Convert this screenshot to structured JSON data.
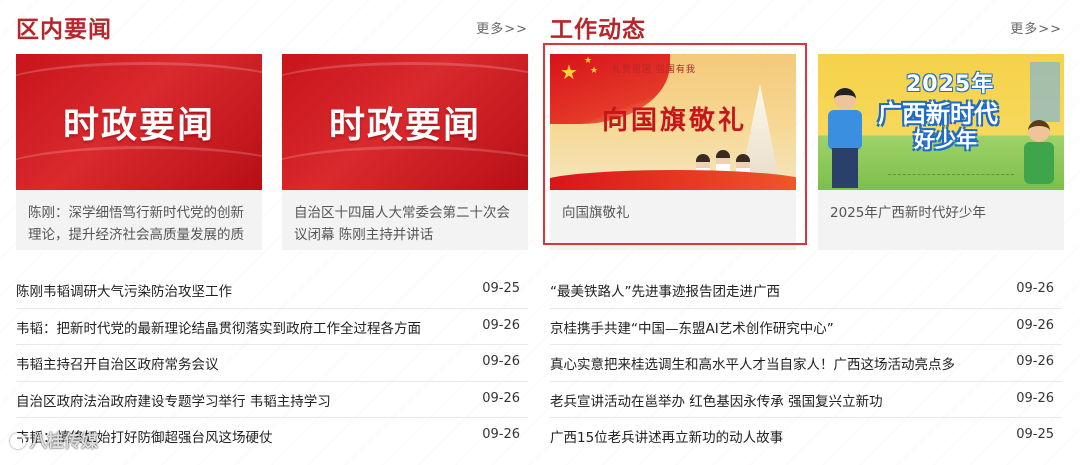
{
  "left_section": {
    "title": "区内要闻",
    "more_label": "更多>>",
    "cards": [
      {
        "image_text": "时政要闻",
        "caption": "陈刚：深学细悟笃行新时代党的创新理论，提升经济社会高质量发展的质效"
      },
      {
        "image_text": "时政要闻",
        "caption": "自治区十四届人大常委会第二十次会议闭幕 陈刚主持并讲话"
      }
    ],
    "news": [
      {
        "title": "陈刚韦韬调研大气污染防治攻坚工作",
        "date": "09-25"
      },
      {
        "title": "韦韬：把新时代党的最新理论结晶贯彻落实到政府工作全过程各方面",
        "date": "09-26"
      },
      {
        "title": "韦韬主持召开自治区政府常务会议",
        "date": "09-26"
      },
      {
        "title": "自治区政府法治政府建设专题学习举行 韦韬主持学习",
        "date": "09-26"
      },
      {
        "title": "韦韬：慎终如始打好防御超强台风这场硬仗",
        "date": "09-26"
      }
    ]
  },
  "right_section": {
    "title": "工作动态",
    "more_label": "更多>>",
    "cards": [
      {
        "image_title": "向国旗敬礼",
        "image_slogan": "礼赞祖国 强国有我",
        "caption": "向国旗敬礼",
        "selected": true
      },
      {
        "image_line1": "2025年",
        "image_line2": "广西新时代",
        "image_line3": "好少年",
        "caption": "2025年广西新时代好少年"
      }
    ],
    "news": [
      {
        "title": "“最美铁路人”先进事迹报告团走进广西",
        "date": "09-26"
      },
      {
        "title": "京桂携手共建“中国—东盟AI艺术创作研究中心”",
        "date": "09-26"
      },
      {
        "title": "真心实意把来桂选调生和高水平人才当自家人！广西这场活动亮点多",
        "date": "09-26"
      },
      {
        "title": "老兵宣讲活动在邕举办 红色基因永传承 强国复兴立新功",
        "date": "09-26"
      },
      {
        "title": "广西15位老兵讲述再立新功的动人故事",
        "date": "09-25"
      }
    ]
  },
  "watermark": "八桂传媒",
  "colors": {
    "accent": "#b8262b",
    "selection": "#d9363b"
  },
  "icons": {
    "star": "star-icon",
    "watermark_logo": "watermark-logo-icon"
  }
}
